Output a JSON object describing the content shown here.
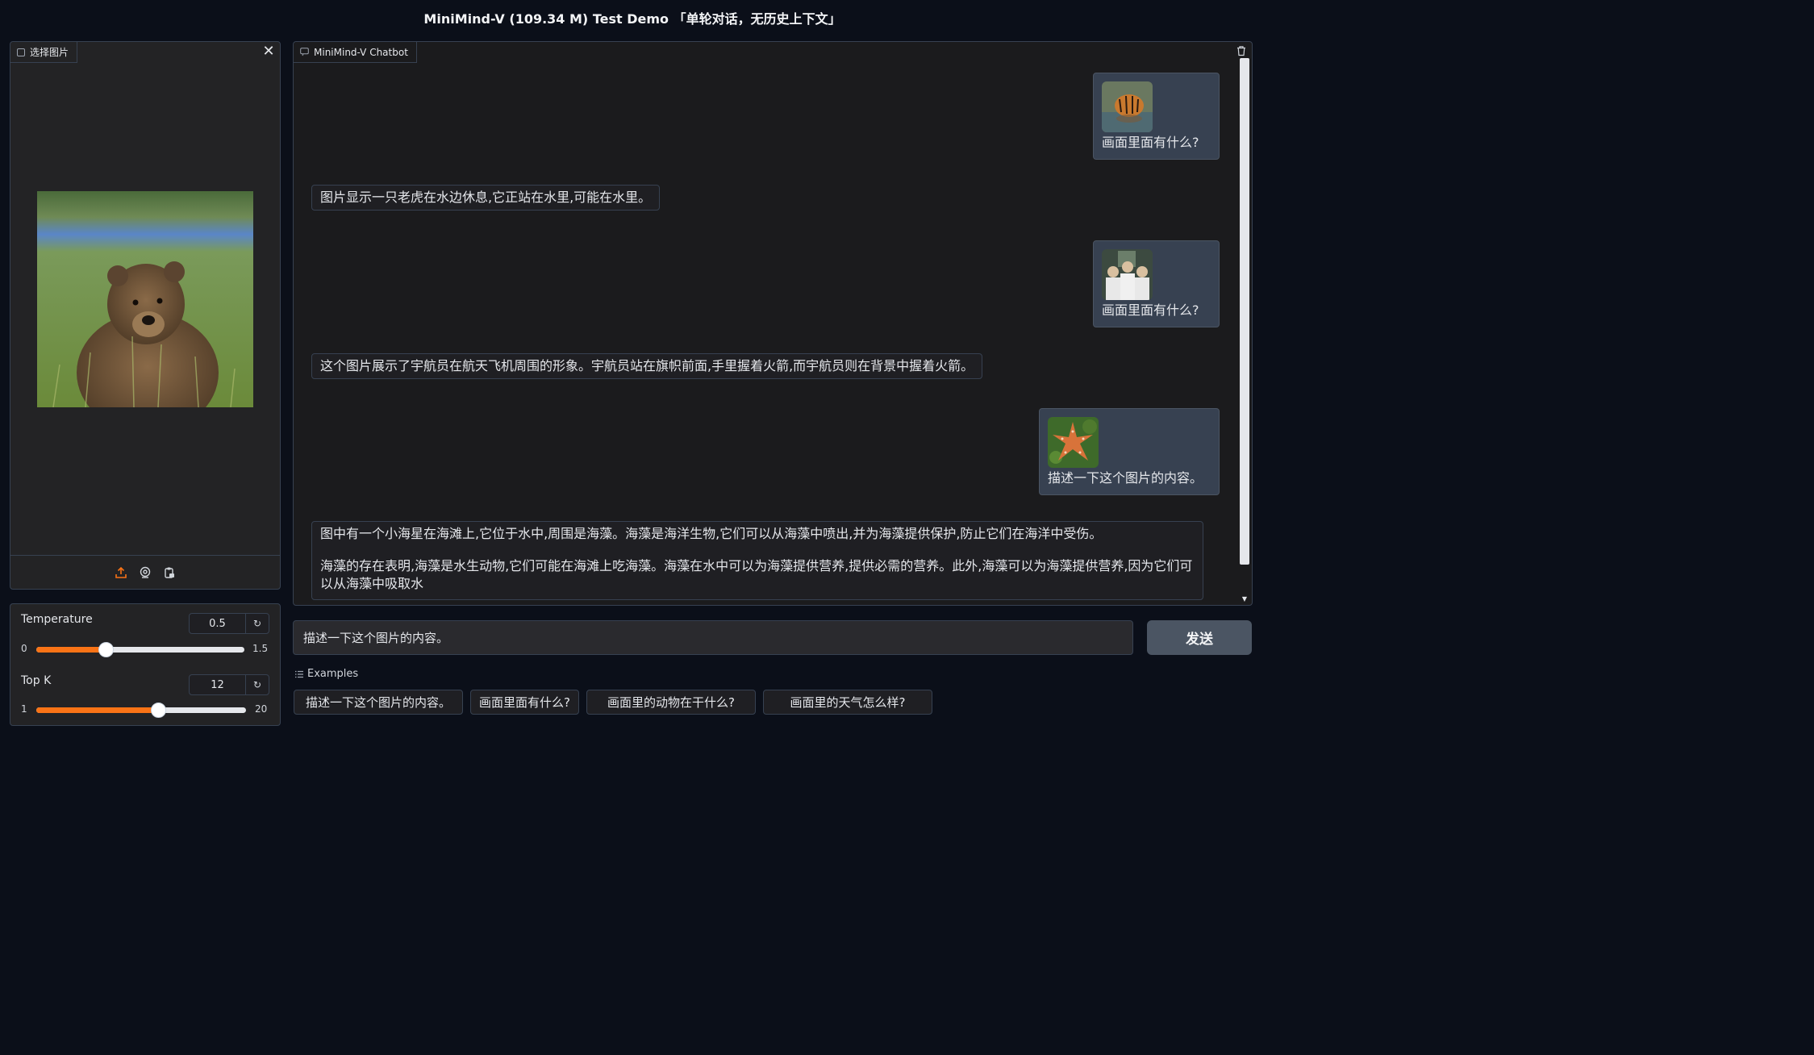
{
  "app": {
    "title": "MiniMind-V (109.34 M) Test Demo 「单轮对话，无历史上下文」"
  },
  "image_panel": {
    "tab_label": "选择图片",
    "close_icon": "close-icon",
    "toolbar_icons": [
      "upload-icon",
      "webcam-icon",
      "clipboard-paste-icon"
    ]
  },
  "controls": {
    "temperature": {
      "label": "Temperature",
      "value": "0.5",
      "min": "0",
      "max": "1.5",
      "fraction": 0.333
    },
    "top_k": {
      "label": "Top K",
      "value": "12",
      "min": "1",
      "max": "20",
      "fraction": 0.579
    },
    "reset_icon": "reset-icon"
  },
  "chatbot": {
    "tab_label": "MiniMind-V Chatbot",
    "messages": [
      {
        "role": "user",
        "image": "tiger-thumbnail",
        "text": "画面里面有什么?"
      },
      {
        "role": "bot",
        "paragraphs": [
          "图片显示一只老虎在水边休息,它正站在水里,可能在水里。"
        ]
      },
      {
        "role": "user",
        "image": "astronauts-thumbnail",
        "text": "画面里面有什么?"
      },
      {
        "role": "bot",
        "paragraphs": [
          "这个图片展示了宇航员在航天飞机周围的形象。宇航员站在旗帜前面,手里握着火箭,而宇航员则在背景中握着火箭。"
        ]
      },
      {
        "role": "user",
        "image": "starfish-thumbnail",
        "text": "描述一下这个图片的内容。"
      },
      {
        "role": "bot",
        "paragraphs": [
          "图中有一个小海星在海滩上,它位于水中,周围是海藻。海藻是海洋生物,它们可以从海藻中喷出,并为海藻提供保护,防止它们在海洋中受伤。",
          "海藻的存在表明,海藻是水生动物,它们可能在海滩上吃海藻。海藻在水中可以为海藻提供营养,提供必需的营养。此外,海藻可以为海藻提供营养,因为它们可以从海藻中吸取水"
        ]
      }
    ]
  },
  "input": {
    "value": "描述一下这个图片的内容。",
    "send_label": "发送"
  },
  "examples": {
    "label": "Examples",
    "items": [
      "描述一下这个图片的内容。",
      "画面里面有什么?",
      "画面里的动物在干什么?",
      "画面里的天气怎么样?"
    ]
  },
  "colors": {
    "background": "#0b0f19",
    "accent": "#f97316",
    "panel": "#1f1f23",
    "user_bubble": "#374151"
  }
}
